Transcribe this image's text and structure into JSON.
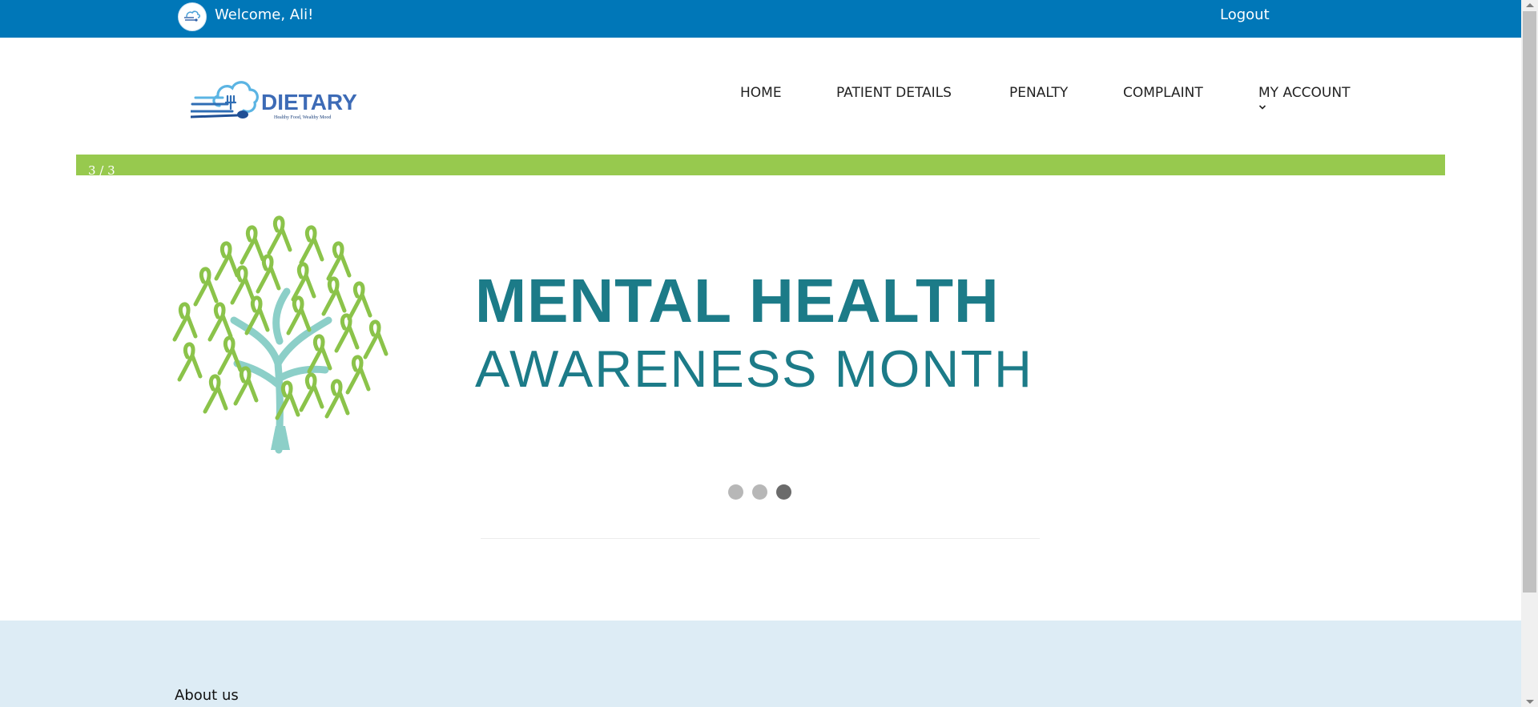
{
  "topbar": {
    "welcome": "Welcome, Ali!",
    "logout": "Logout",
    "bg_color": "#0077b8"
  },
  "logo": {
    "title": "DIETARY",
    "tagline": "Healthy Food, Wealthy Mood"
  },
  "nav": {
    "items": [
      {
        "label": "HOME"
      },
      {
        "label": "PATIENT DETAILS"
      },
      {
        "label": "PENALTY"
      },
      {
        "label": "COMPLAINT"
      },
      {
        "label": "MY ACCOUNT",
        "has_dropdown": true
      }
    ]
  },
  "slider": {
    "counter": "3 / 3",
    "current": 3,
    "total": 3,
    "bar_color": "#97c94e",
    "banner": {
      "line1": "MENTAL HEALTH",
      "line2": "AWARENESS MONTH",
      "text_color": "#1c7b88",
      "ribbon_color": "#8bc34a",
      "trunk_color": "#8ccfc8"
    }
  },
  "footer": {
    "about": "About us",
    "bg_color": "#ddecf5"
  }
}
